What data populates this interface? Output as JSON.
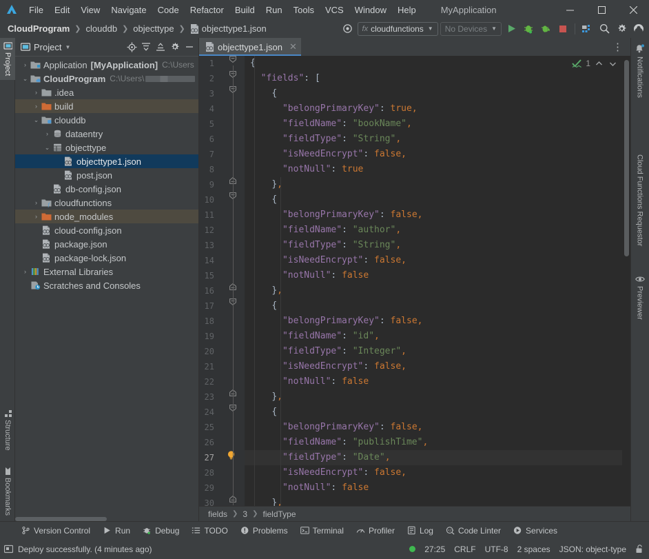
{
  "window": {
    "app_title": "MyApplication",
    "minimize": "─",
    "maximize": "☐",
    "close": "✕"
  },
  "menubar": {
    "items": [
      "File",
      "Edit",
      "View",
      "Navigate",
      "Code",
      "Refactor",
      "Build",
      "Run",
      "Tools",
      "VCS",
      "Window",
      "Help"
    ]
  },
  "navbar": {
    "breadcrumbs": [
      "CloudProgram",
      "clouddb",
      "objecttype",
      "objecttype1.json"
    ],
    "run_config": "cloudfunctions",
    "device": "No Devices",
    "icons": {
      "target": "target-icon",
      "run": "run-icon",
      "debug": "debug-icon",
      "attach_debug": "attach-debugger-icon",
      "stop": "stop-icon",
      "device_manager": "device-manager-icon",
      "search": "search-icon",
      "settings": "gear-icon",
      "account": "account-icon"
    }
  },
  "left_tool_strip": {
    "tabs": [
      {
        "label": "Project",
        "icon": "project-icon",
        "active": true
      },
      {
        "label": "Structure",
        "icon": "structure-icon",
        "active": false
      },
      {
        "label": "Bookmarks",
        "icon": "bookmarks-icon",
        "active": false
      }
    ]
  },
  "right_tool_strip": {
    "tabs": [
      {
        "label": "Notifications",
        "icon": "notifications-icon"
      },
      {
        "label": "Cloud Functions Requestor",
        "icon": "cloud-functions-icon"
      },
      {
        "label": "Previewer",
        "icon": "eye-icon"
      }
    ]
  },
  "project_panel": {
    "title": "Project",
    "header_icons": [
      "select-opened-file-icon",
      "expand-all-icon",
      "collapse-all-icon",
      "gear-icon",
      "hide-icon"
    ],
    "tree": [
      {
        "indent": 0,
        "arrow": "›",
        "icon": "module-icon",
        "label": "Application",
        "bold_label": "[MyApplication]",
        "detail": "C:\\Users",
        "state": "normal"
      },
      {
        "indent": 0,
        "arrow": "⌄",
        "icon": "module-cloud-icon",
        "label": "CloudProgram",
        "bold_label": "",
        "detail": "C:\\Users\\",
        "state": "normal",
        "redacted": true,
        "bold": true
      },
      {
        "indent": 1,
        "arrow": "›",
        "icon": "folder-icon",
        "label": ".idea",
        "state": "normal"
      },
      {
        "indent": 1,
        "arrow": "›",
        "icon": "folder-orange-icon",
        "label": "build",
        "state": "hover"
      },
      {
        "indent": 1,
        "arrow": "⌄",
        "icon": "folder-db-icon",
        "label": "clouddb",
        "state": "normal"
      },
      {
        "indent": 2,
        "arrow": "›",
        "icon": "database-icon",
        "label": "dataentry",
        "state": "normal"
      },
      {
        "indent": 2,
        "arrow": "⌄",
        "icon": "table-icon",
        "label": "objecttype",
        "state": "normal"
      },
      {
        "indent": 3,
        "arrow": "",
        "icon": "json-icon",
        "label": "objecttype1.json",
        "state": "selected"
      },
      {
        "indent": 3,
        "arrow": "",
        "icon": "json-icon",
        "label": "post.json",
        "state": "normal"
      },
      {
        "indent": 2,
        "arrow": "",
        "icon": "json-icon",
        "label": "db-config.json",
        "state": "normal"
      },
      {
        "indent": 1,
        "arrow": "›",
        "icon": "folder-fn-icon",
        "label": "cloudfunctions",
        "state": "normal"
      },
      {
        "indent": 1,
        "arrow": "›",
        "icon": "folder-orange-icon",
        "label": "node_modules",
        "state": "hover"
      },
      {
        "indent": 1,
        "arrow": "",
        "icon": "json-icon",
        "label": "cloud-config.json",
        "state": "normal"
      },
      {
        "indent": 1,
        "arrow": "",
        "icon": "json-icon",
        "label": "package.json",
        "state": "normal"
      },
      {
        "indent": 1,
        "arrow": "",
        "icon": "json-icon",
        "label": "package-lock.json",
        "state": "normal"
      },
      {
        "indent": 0,
        "arrow": "›",
        "icon": "libraries-icon",
        "label": "External Libraries",
        "state": "normal"
      },
      {
        "indent": 0,
        "arrow": "",
        "icon": "scratches-icon",
        "label": "Scratches and Consoles",
        "state": "normal"
      }
    ]
  },
  "editor": {
    "tab": {
      "label": "objecttype1.json",
      "icon": "json-icon",
      "close": "✕"
    },
    "inspection": {
      "count": "1",
      "status_icon": "inspection-ok-icon",
      "up": "⌃",
      "down": "⌄"
    },
    "breadcrumbs": [
      "fields",
      "3",
      "fieldType"
    ],
    "current_line": 27,
    "lines": [
      {
        "n": 1,
        "fold": "minus",
        "tokens": [
          {
            "t": "{",
            "c": "p"
          }
        ]
      },
      {
        "n": 2,
        "fold": "minus",
        "tokens": [
          {
            "t": "  ",
            "c": "p"
          },
          {
            "t": "\"fields\"",
            "c": "k"
          },
          {
            "t": ": ",
            "c": "p"
          },
          {
            "t": "[",
            "c": "p"
          }
        ]
      },
      {
        "n": 3,
        "fold": "minus",
        "tokens": [
          {
            "t": "    ",
            "c": "p"
          },
          {
            "t": "{",
            "c": "p"
          }
        ]
      },
      {
        "n": 4,
        "fold": "",
        "tokens": [
          {
            "t": "      ",
            "c": "p"
          },
          {
            "t": "\"belongPrimaryKey\"",
            "c": "k"
          },
          {
            "t": ": ",
            "c": "p"
          },
          {
            "t": "true",
            "c": "n"
          },
          {
            "t": ",",
            "c": "n"
          }
        ]
      },
      {
        "n": 5,
        "fold": "",
        "tokens": [
          {
            "t": "      ",
            "c": "p"
          },
          {
            "t": "\"fieldName\"",
            "c": "k"
          },
          {
            "t": ": ",
            "c": "p"
          },
          {
            "t": "\"bookName\"",
            "c": "s"
          },
          {
            "t": ",",
            "c": "n"
          }
        ]
      },
      {
        "n": 6,
        "fold": "",
        "tokens": [
          {
            "t": "      ",
            "c": "p"
          },
          {
            "t": "\"fieldType\"",
            "c": "k"
          },
          {
            "t": ": ",
            "c": "p"
          },
          {
            "t": "\"String\"",
            "c": "s"
          },
          {
            "t": ",",
            "c": "n"
          }
        ]
      },
      {
        "n": 7,
        "fold": "",
        "tokens": [
          {
            "t": "      ",
            "c": "p"
          },
          {
            "t": "\"isNeedEncrypt\"",
            "c": "k"
          },
          {
            "t": ": ",
            "c": "p"
          },
          {
            "t": "false",
            "c": "n"
          },
          {
            "t": ",",
            "c": "n"
          }
        ]
      },
      {
        "n": 8,
        "fold": "",
        "tokens": [
          {
            "t": "      ",
            "c": "p"
          },
          {
            "t": "\"notNull\"",
            "c": "k"
          },
          {
            "t": ": ",
            "c": "p"
          },
          {
            "t": "true",
            "c": "n"
          }
        ]
      },
      {
        "n": 9,
        "fold": "end",
        "tokens": [
          {
            "t": "    ",
            "c": "p"
          },
          {
            "t": "}",
            "c": "p"
          },
          {
            "t": ",",
            "c": "n"
          }
        ]
      },
      {
        "n": 10,
        "fold": "minus",
        "tokens": [
          {
            "t": "    ",
            "c": "p"
          },
          {
            "t": "{",
            "c": "p"
          }
        ]
      },
      {
        "n": 11,
        "fold": "",
        "tokens": [
          {
            "t": "      ",
            "c": "p"
          },
          {
            "t": "\"belongPrimaryKey\"",
            "c": "k"
          },
          {
            "t": ": ",
            "c": "p"
          },
          {
            "t": "false",
            "c": "n"
          },
          {
            "t": ",",
            "c": "n"
          }
        ]
      },
      {
        "n": 12,
        "fold": "",
        "tokens": [
          {
            "t": "      ",
            "c": "p"
          },
          {
            "t": "\"fieldName\"",
            "c": "k"
          },
          {
            "t": ": ",
            "c": "p"
          },
          {
            "t": "\"author\"",
            "c": "s"
          },
          {
            "t": ",",
            "c": "n"
          }
        ]
      },
      {
        "n": 13,
        "fold": "",
        "tokens": [
          {
            "t": "      ",
            "c": "p"
          },
          {
            "t": "\"fieldType\"",
            "c": "k"
          },
          {
            "t": ": ",
            "c": "p"
          },
          {
            "t": "\"String\"",
            "c": "s"
          },
          {
            "t": ",",
            "c": "n"
          }
        ]
      },
      {
        "n": 14,
        "fold": "",
        "tokens": [
          {
            "t": "      ",
            "c": "p"
          },
          {
            "t": "\"isNeedEncrypt\"",
            "c": "k"
          },
          {
            "t": ": ",
            "c": "p"
          },
          {
            "t": "false",
            "c": "n"
          },
          {
            "t": ",",
            "c": "n"
          }
        ]
      },
      {
        "n": 15,
        "fold": "",
        "tokens": [
          {
            "t": "      ",
            "c": "p"
          },
          {
            "t": "\"notNull\"",
            "c": "k"
          },
          {
            "t": ": ",
            "c": "p"
          },
          {
            "t": "false",
            "c": "n"
          }
        ]
      },
      {
        "n": 16,
        "fold": "end",
        "tokens": [
          {
            "t": "    ",
            "c": "p"
          },
          {
            "t": "}",
            "c": "p"
          },
          {
            "t": ",",
            "c": "n"
          }
        ]
      },
      {
        "n": 17,
        "fold": "minus",
        "tokens": [
          {
            "t": "    ",
            "c": "p"
          },
          {
            "t": "{",
            "c": "p"
          }
        ]
      },
      {
        "n": 18,
        "fold": "",
        "tokens": [
          {
            "t": "      ",
            "c": "p"
          },
          {
            "t": "\"belongPrimaryKey\"",
            "c": "k"
          },
          {
            "t": ": ",
            "c": "p"
          },
          {
            "t": "false",
            "c": "n"
          },
          {
            "t": ",",
            "c": "n"
          }
        ]
      },
      {
        "n": 19,
        "fold": "",
        "tokens": [
          {
            "t": "      ",
            "c": "p"
          },
          {
            "t": "\"fieldName\"",
            "c": "k"
          },
          {
            "t": ": ",
            "c": "p"
          },
          {
            "t": "\"id\"",
            "c": "s"
          },
          {
            "t": ",",
            "c": "n"
          }
        ]
      },
      {
        "n": 20,
        "fold": "",
        "tokens": [
          {
            "t": "      ",
            "c": "p"
          },
          {
            "t": "\"fieldType\"",
            "c": "k"
          },
          {
            "t": ": ",
            "c": "p"
          },
          {
            "t": "\"Integer\"",
            "c": "s"
          },
          {
            "t": ",",
            "c": "n"
          }
        ]
      },
      {
        "n": 21,
        "fold": "",
        "tokens": [
          {
            "t": "      ",
            "c": "p"
          },
          {
            "t": "\"isNeedEncrypt\"",
            "c": "k"
          },
          {
            "t": ": ",
            "c": "p"
          },
          {
            "t": "false",
            "c": "n"
          },
          {
            "t": ",",
            "c": "n"
          }
        ]
      },
      {
        "n": 22,
        "fold": "",
        "tokens": [
          {
            "t": "      ",
            "c": "p"
          },
          {
            "t": "\"notNull\"",
            "c": "k"
          },
          {
            "t": ": ",
            "c": "p"
          },
          {
            "t": "false",
            "c": "n"
          }
        ]
      },
      {
        "n": 23,
        "fold": "end",
        "tokens": [
          {
            "t": "    ",
            "c": "p"
          },
          {
            "t": "}",
            "c": "p"
          },
          {
            "t": ",",
            "c": "n"
          }
        ]
      },
      {
        "n": 24,
        "fold": "minus",
        "tokens": [
          {
            "t": "    ",
            "c": "p"
          },
          {
            "t": "{",
            "c": "p"
          }
        ]
      },
      {
        "n": 25,
        "fold": "",
        "tokens": [
          {
            "t": "      ",
            "c": "p"
          },
          {
            "t": "\"belongPrimaryKey\"",
            "c": "k"
          },
          {
            "t": ": ",
            "c": "p"
          },
          {
            "t": "false",
            "c": "n"
          },
          {
            "t": ",",
            "c": "n"
          }
        ]
      },
      {
        "n": 26,
        "fold": "",
        "tokens": [
          {
            "t": "      ",
            "c": "p"
          },
          {
            "t": "\"fieldName\"",
            "c": "k"
          },
          {
            "t": ": ",
            "c": "p"
          },
          {
            "t": "\"publishTime\"",
            "c": "s"
          },
          {
            "t": ",",
            "c": "n"
          }
        ]
      },
      {
        "n": 27,
        "fold": "bulb",
        "tokens": [
          {
            "t": "      ",
            "c": "p"
          },
          {
            "t": "\"fieldType\"",
            "c": "k"
          },
          {
            "t": ": ",
            "c": "p"
          },
          {
            "t": "\"Date\"",
            "c": "s"
          },
          {
            "t": ",",
            "c": "n"
          }
        ]
      },
      {
        "n": 28,
        "fold": "",
        "tokens": [
          {
            "t": "      ",
            "c": "p"
          },
          {
            "t": "\"isNeedEncrypt\"",
            "c": "k"
          },
          {
            "t": ": ",
            "c": "p"
          },
          {
            "t": "false",
            "c": "n"
          },
          {
            "t": ",",
            "c": "n"
          }
        ]
      },
      {
        "n": 29,
        "fold": "",
        "tokens": [
          {
            "t": "      ",
            "c": "p"
          },
          {
            "t": "\"notNull\"",
            "c": "k"
          },
          {
            "t": ": ",
            "c": "p"
          },
          {
            "t": "false",
            "c": "n"
          }
        ]
      },
      {
        "n": 30,
        "fold": "end",
        "tokens": [
          {
            "t": "    ",
            "c": "p"
          },
          {
            "t": "}",
            "c": "p"
          },
          {
            "t": ",",
            "c": "n"
          }
        ]
      }
    ]
  },
  "bottom_toolwindows": [
    {
      "label": "Version Control",
      "icon": "branch-icon"
    },
    {
      "label": "Run",
      "icon": "run-icon"
    },
    {
      "label": "Debug",
      "icon": "debug-icon"
    },
    {
      "label": "TODO",
      "icon": "todo-icon"
    },
    {
      "label": "Problems",
      "icon": "problems-icon"
    },
    {
      "label": "Terminal",
      "icon": "terminal-icon"
    },
    {
      "label": "Profiler",
      "icon": "profiler-icon"
    },
    {
      "label": "Log",
      "icon": "log-icon"
    },
    {
      "label": "Code Linter",
      "icon": "linter-icon"
    },
    {
      "label": "Services",
      "icon": "services-icon"
    }
  ],
  "statusbar": {
    "message": "Deploy successfully. (4 minutes ago)",
    "message_icon": "console-icon",
    "caret_position": "27:25",
    "line_separator": "CRLF",
    "encoding": "UTF-8",
    "indent": "2 spaces",
    "file_type": "JSON: object-type",
    "lock_icon": "unlocked-icon",
    "status_indicator_color": "#3fb950"
  }
}
